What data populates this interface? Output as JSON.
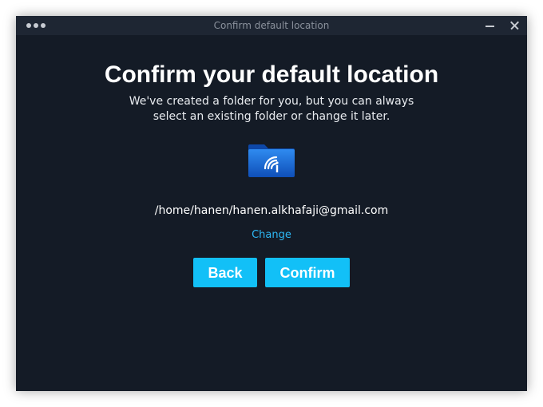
{
  "window": {
    "title": "Confirm default location"
  },
  "main": {
    "heading": "Confirm your default location",
    "subtext_line1": "We've created a folder for you, but you can always",
    "subtext_line2": "select an existing folder or change it later.",
    "path": "/home/hanen/hanen.alkhafaji@gmail.com",
    "change_label": "Change",
    "back_label": "Back",
    "confirm_label": "Confirm",
    "folder_icon": "synced-folder-icon"
  },
  "colors": {
    "background": "#141b26",
    "titlebar": "#1e2633",
    "accent": "#12c0f7",
    "link": "#2db8f5",
    "folder": "#1565d8"
  }
}
